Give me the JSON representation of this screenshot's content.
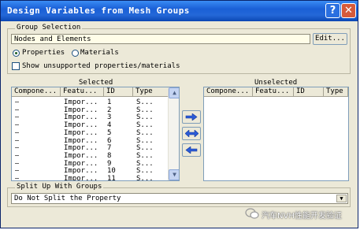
{
  "window": {
    "title": "Design Variables from Mesh Groups",
    "help_label": "?",
    "close_label": "✕"
  },
  "group_selection": {
    "legend": "Group Selection",
    "field_value": "Nodes and Elements",
    "edit_label": "Edit...",
    "radio_properties": "Properties",
    "radio_materials": "Materials",
    "checkbox_label": "Show unsupported properties/materials"
  },
  "selected": {
    "title": "Selected",
    "columns": [
      "Compone...",
      "Featu...",
      "ID",
      "Type"
    ],
    "rows": [
      [
        "–",
        "Impor...",
        "1",
        "S..."
      ],
      [
        "–",
        "Impor...",
        "2",
        "S..."
      ],
      [
        "–",
        "Impor...",
        "3",
        "S..."
      ],
      [
        "–",
        "Impor...",
        "4",
        "S..."
      ],
      [
        "–",
        "Impor...",
        "5",
        "S..."
      ],
      [
        "–",
        "Impor...",
        "6",
        "S..."
      ],
      [
        "–",
        "Impor...",
        "7",
        "S..."
      ],
      [
        "–",
        "Impor...",
        "8",
        "S..."
      ],
      [
        "–",
        "Impor...",
        "9",
        "S..."
      ],
      [
        "–",
        "Impor...",
        "10",
        "S..."
      ],
      [
        "–",
        "Impor...",
        "11",
        "S..."
      ]
    ]
  },
  "unselected": {
    "title": "Unselected",
    "columns": [
      "Compone...",
      "Featu...",
      "ID",
      "Type"
    ]
  },
  "split": {
    "legend": "Split Up With Groups",
    "value": "Do Not Split the Property"
  },
  "watermark": "汽车NVH性能开发验证",
  "colors": {
    "titlebar": "#1a5fd6",
    "dialog_bg": "#ece9d8",
    "field_bg": "#fffde8",
    "arrow": "#2a5bd7"
  }
}
